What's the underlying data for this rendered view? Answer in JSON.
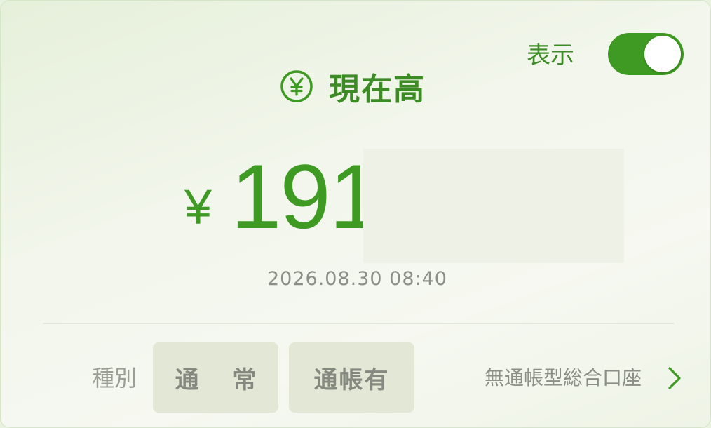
{
  "header": {
    "display_label": "表示",
    "display_toggle_on": true,
    "title": "現在高",
    "title_icon": "yen-circle-icon"
  },
  "balance": {
    "currency_symbol": "¥",
    "amount": "191",
    "timestamp": "2026.08.30 08:40"
  },
  "account": {
    "type_label": "種別",
    "tags": [
      "通 常",
      "通帳有"
    ],
    "account_type": "無通帳型総合口座",
    "chevron_icon": "chevron-right-icon"
  },
  "colors": {
    "accent": "#3e9a22",
    "muted_text": "#8a8f87",
    "chip_bg": "#e3e8d6"
  }
}
